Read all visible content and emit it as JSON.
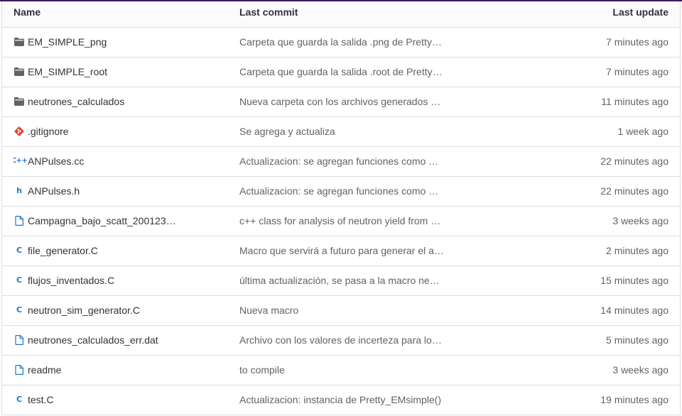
{
  "columns": {
    "name": "Name",
    "last_commit": "Last commit",
    "last_update": "Last update"
  },
  "rows": [
    {
      "icon": "folder-icon",
      "name": "EM_SIMPLE_png",
      "commit": "Carpeta que guarda la salida .png de Pretty_…",
      "updated": "7 minutes ago"
    },
    {
      "icon": "folder-icon",
      "name": "EM_SIMPLE_root",
      "commit": "Carpeta que guarda la salida .root de Pretty_…",
      "updated": "7 minutes ago"
    },
    {
      "icon": "folder-icon",
      "name": "neutrones_calculados",
      "commit": "Nueva carpeta con los archivos generados d…",
      "updated": "11 minutes ago"
    },
    {
      "icon": "git-icon",
      "name": ".gitignore",
      "commit": "Se agrega y actualiza",
      "updated": "1 week ago"
    },
    {
      "icon": "cpp-icon",
      "name": "ANPulses.cc",
      "commit": "Actualizacion: se agregan funciones como P…",
      "updated": "22 minutes ago"
    },
    {
      "icon": "h-file-icon",
      "name": "ANPulses.h",
      "commit": "Actualizacion: se agregan funciones como P…",
      "updated": "22 minutes ago"
    },
    {
      "icon": "file-icon",
      "name": "Campagna_bajo_scatt_200123_…",
      "commit": "c++ class for analysis of neutron yield from …",
      "updated": "3 weeks ago"
    },
    {
      "icon": "c-file-icon",
      "name": "file_generator.C",
      "commit": "Macro que servirá a futuro para generar el ar…",
      "updated": "2 minutes ago"
    },
    {
      "icon": "c-file-icon",
      "name": "flujos_inventados.C",
      "commit": "última actualización, se pasa a la macro neu…",
      "updated": "15 minutes ago"
    },
    {
      "icon": "c-file-icon",
      "name": "neutron_sim_generator.C",
      "commit": "Nueva macro",
      "updated": "14 minutes ago"
    },
    {
      "icon": "file-icon",
      "name": "neutrones_calculados_err.dat",
      "commit": "Archivo con los valores de incerteza para los…",
      "updated": "5 minutes ago"
    },
    {
      "icon": "file-icon",
      "name": "readme",
      "commit": "to compile",
      "updated": "3 weeks ago"
    },
    {
      "icon": "c-file-icon",
      "name": "test.C",
      "commit": "Actualizacion: instancia de Pretty_EMsimple()",
      "updated": "19 minutes ago"
    }
  ],
  "colors": {
    "link_blue": "#1f75cb",
    "folder_gray": "#626168",
    "git_orange": "#e24329",
    "top_border": "#3b1d5e"
  }
}
